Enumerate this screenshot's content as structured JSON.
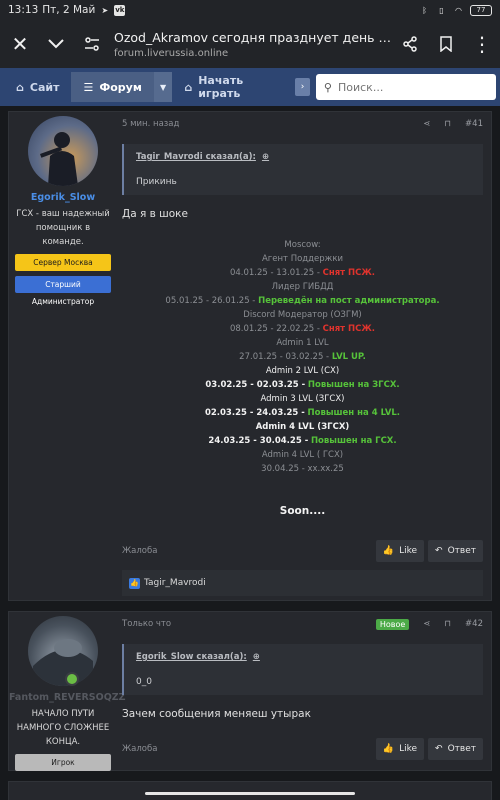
{
  "statusbar": {
    "time": "13:13",
    "date": "Пт, 2 Май",
    "battery": "77"
  },
  "browser": {
    "title": "Ozod_Akramov сегодня празднует день рождение | Стран...",
    "url": "forum.liverussia.online"
  },
  "nav": {
    "tabs": [
      {
        "label": "Сайт",
        "icon": "tag-icon"
      },
      {
        "label": "Форум",
        "icon": "chat-bubbles-icon"
      },
      {
        "label": "Начать играть",
        "icon": "tag-icon"
      }
    ],
    "search_placeholder": "Поиск..."
  },
  "posts": [
    {
      "user": {
        "name": "Egorik_Slow",
        "title": "ГСХ - ваш надежный помощник в команде.",
        "badges": [
          "Сервер Москва",
          "Старший Администратор"
        ]
      },
      "time": "5 мин. назад",
      "number": "#41",
      "quote": {
        "author": "Tagir_Mavrodi сказал(а):",
        "text": "Прикинь"
      },
      "text": "Да я в шоке",
      "history": [
        {
          "text": "Moscow:"
        },
        {
          "text": "Агент Поддержки"
        },
        {
          "dates": "04.01.25 - 13.01.25 -",
          "status": "Снят ПСЖ."
        },
        {
          "text": "Лидер ГИБДД"
        },
        {
          "dates": "05.01.25 - 26.01.25 -",
          "status": "Переведён на пост администратора."
        },
        {
          "text": "Discord Модератор (ОЗГМ)"
        },
        {
          "dates": "08.01.25 - 22.02.25 -",
          "status": "Снят ПСЖ."
        },
        {
          "text": "Admin 1 LVL"
        },
        {
          "dates": "27.01.25 - 03.02.25 -",
          "status": "LVL UP."
        },
        {
          "text": "Admin 2 LVL (СХ)"
        },
        {
          "dates": "03.02.25 - 02.03.25 -",
          "status": "Повышен на ЗГСХ."
        },
        {
          "text": "Admin 3 LVL (ЗГСХ)"
        },
        {
          "dates": "02.03.25 - 24.03.25 -",
          "status": "Повышен на 4 LVL."
        },
        {
          "text": "Admin 4 LVL (ЗГСХ)"
        },
        {
          "dates": "24.03.25 - 30.04.25 -",
          "status": "Повышен на ГСХ."
        },
        {
          "text": "Admin 4 LVL ( ГСХ)"
        },
        {
          "dates": "30.04.25 - xx.xx.25"
        }
      ],
      "soon": "Soon....",
      "report": "Жалоба",
      "like_label": "Like",
      "reply_label": "Ответ",
      "liked_by": "Tagir_Mavrodi"
    },
    {
      "user": {
        "name": "Fantom_REVERSOQZZ",
        "title": "НАЧАЛО ПУТИ НАМНОГО СЛОЖНЕЕ КОНЦА.",
        "badges": [
          "Игрок"
        ]
      },
      "time": "Только что",
      "new_label": "Новое",
      "number": "#42",
      "quote": {
        "author": "Egorik_Slow сказал(а):",
        "text": "0_0"
      },
      "text": "Зачем сообщения меняеш утырак",
      "report": "Жалоба",
      "like_label": "Like",
      "reply_label": "Ответ"
    }
  ]
}
